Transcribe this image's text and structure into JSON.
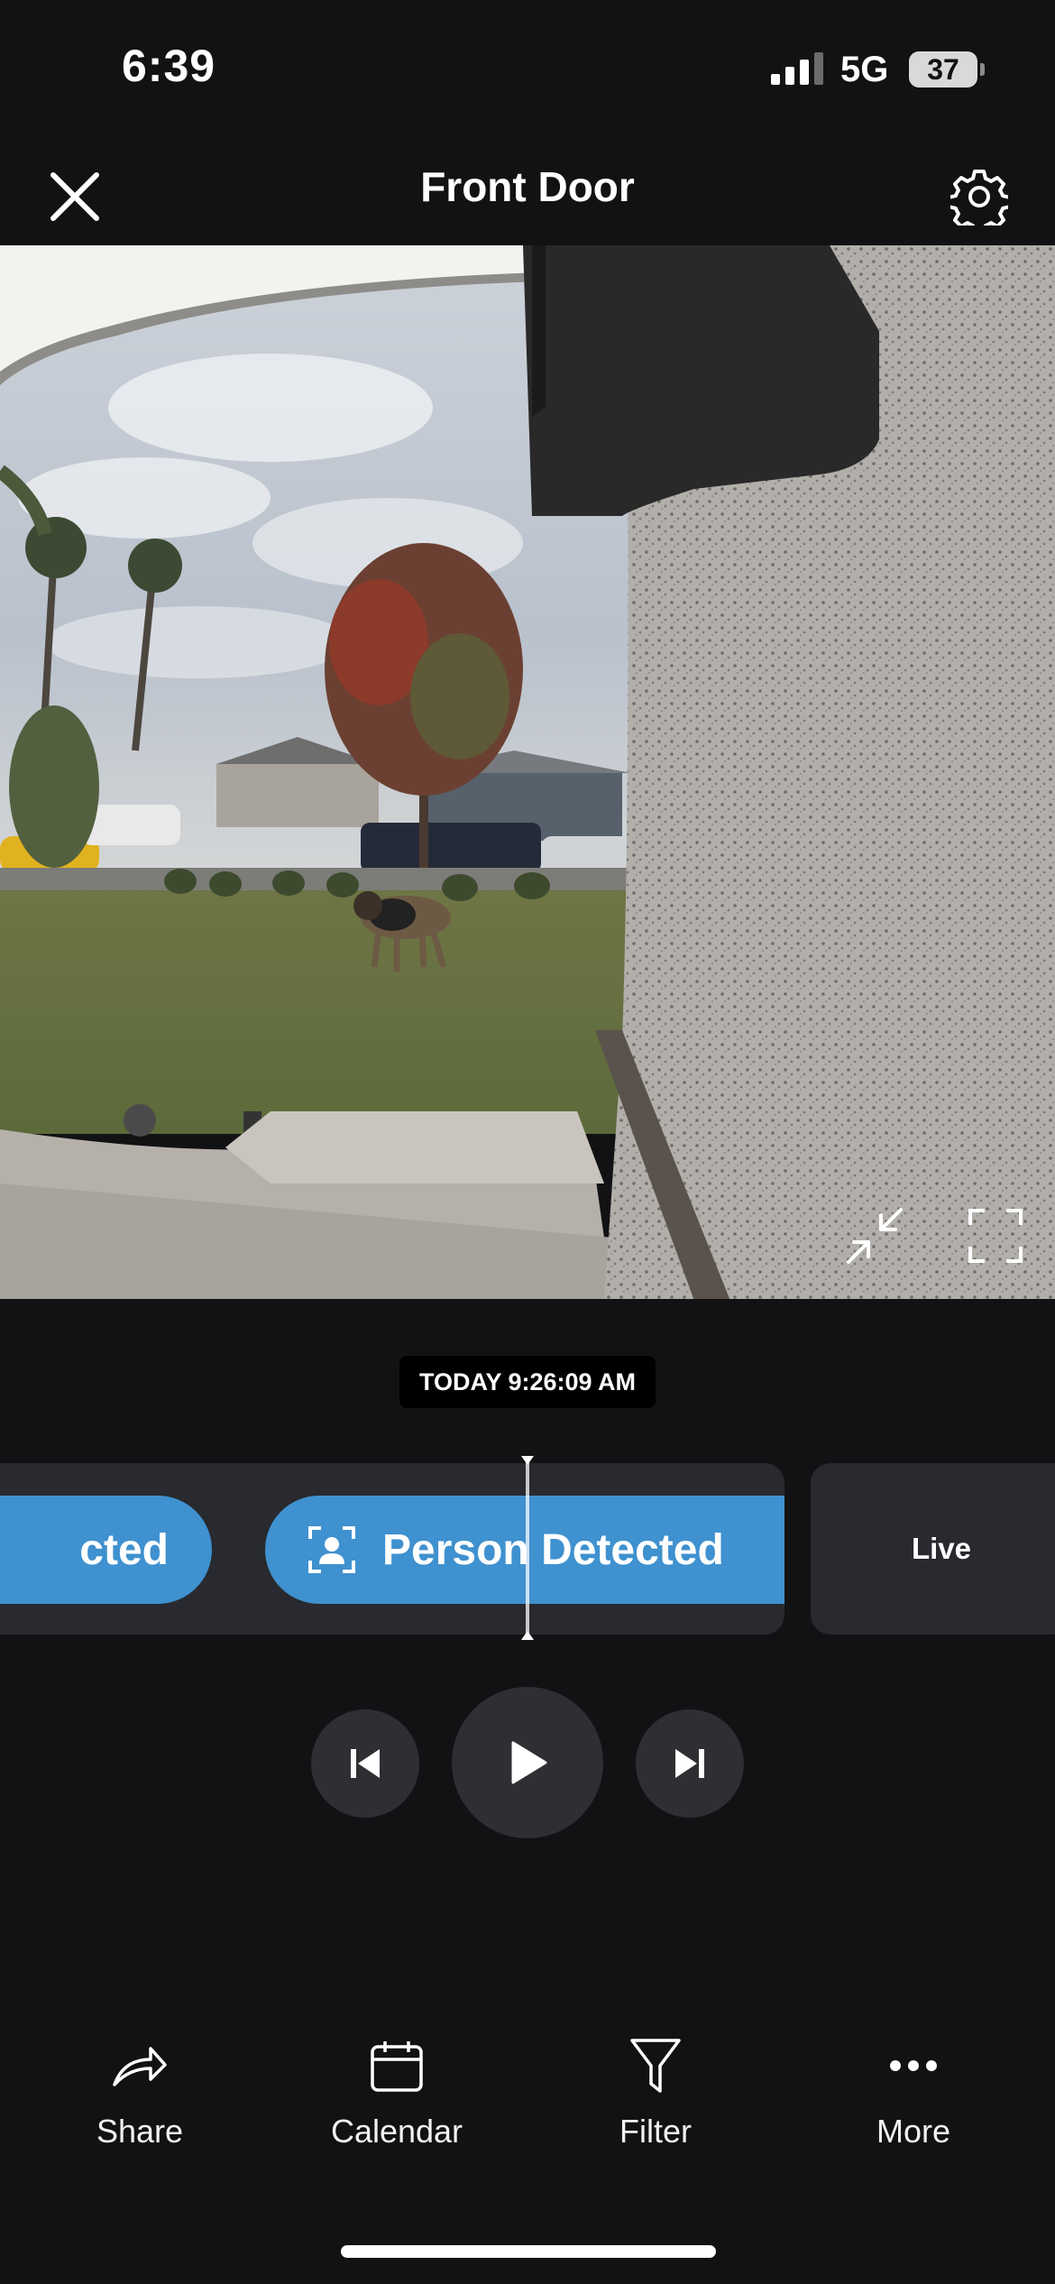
{
  "status_bar": {
    "time": "6:39",
    "network": "5G",
    "battery": "37"
  },
  "header": {
    "title": "Front Door"
  },
  "player": {
    "timestamp": "TODAY 9:26:09 AM"
  },
  "timeline": {
    "events": [
      {
        "label": "cted"
      },
      {
        "label": "Person Detected"
      }
    ],
    "live_label": "Live"
  },
  "bottom_nav": [
    {
      "label": "Share",
      "icon": "share-icon"
    },
    {
      "label": "Calendar",
      "icon": "calendar-icon"
    },
    {
      "label": "Filter",
      "icon": "filter-icon"
    },
    {
      "label": "More",
      "icon": "more-icon"
    }
  ],
  "colors": {
    "accent": "#3f91cf",
    "background": "#121214",
    "panel": "#282a2f"
  }
}
